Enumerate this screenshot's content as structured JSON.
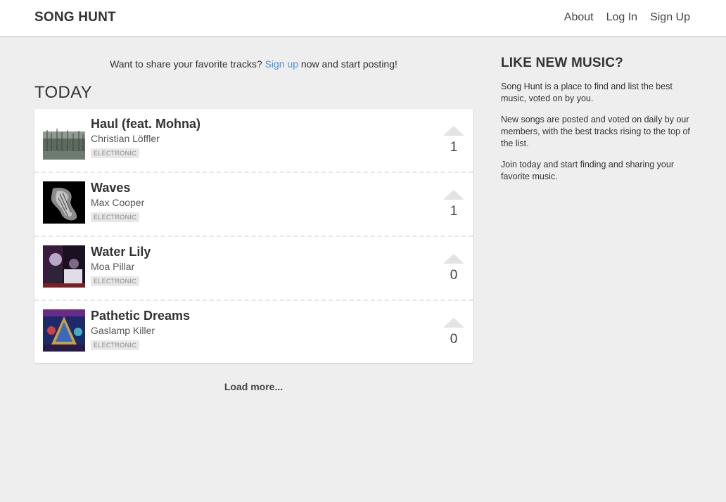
{
  "header": {
    "brand": "SONG HUNT",
    "nav": [
      "About",
      "Log In",
      "Sign Up"
    ]
  },
  "main": {
    "invite_before": "Want to share your favorite tracks? ",
    "invite_link": "Sign up",
    "invite_after": " now and start posting!",
    "section_title": "TODAY",
    "tracks": [
      {
        "title": "Haul (feat. Mohna)",
        "artist": "Christian Löffler",
        "genre": "ELECTRONIC",
        "votes": "1"
      },
      {
        "title": "Waves",
        "artist": "Max Cooper",
        "genre": "ELECTRONIC",
        "votes": "1"
      },
      {
        "title": "Water Lily",
        "artist": "Moa Pillar",
        "genre": "ELECTRONIC",
        "votes": "0"
      },
      {
        "title": "Pathetic Dreams",
        "artist": "Gaslamp Killer",
        "genre": "ELECTRONIC",
        "votes": "0"
      }
    ],
    "load_more": "Load more..."
  },
  "sidebar": {
    "heading": "LIKE NEW MUSIC?",
    "paragraphs": [
      "Song Hunt is a place to find and list the best music, voted on by you.",
      "New songs are posted and voted on daily by our members, with the best tracks rising to the top of the list.",
      "Join today and start finding and sharing your favorite music."
    ]
  },
  "colors": {
    "link": "#4a90d9",
    "background": "#eeeeee"
  }
}
